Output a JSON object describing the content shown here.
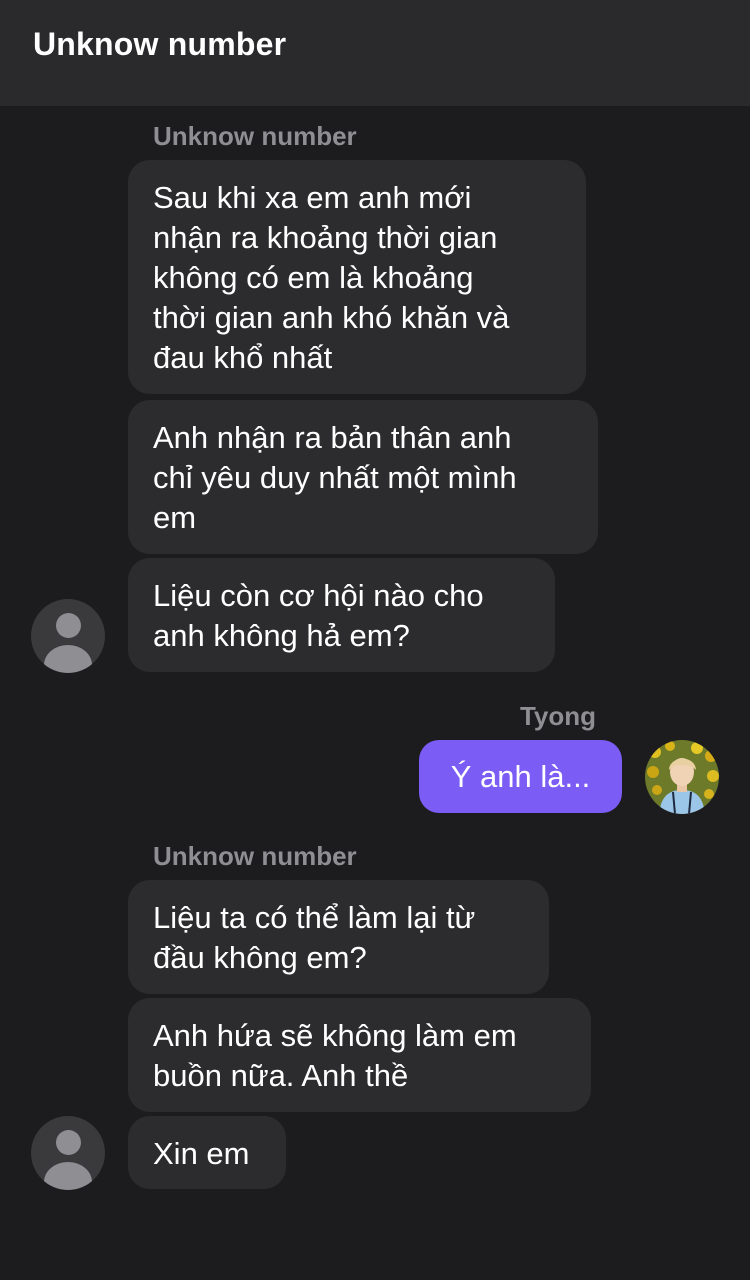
{
  "header": {
    "title": "Unknow number"
  },
  "groups": [
    {
      "sender": "Unknow number",
      "messages": [
        "Sau khi xa em anh mới\nnhận ra khoảng thời gian\nkhông có em là khoảng\nthời gian anh khó khăn và\nđau khổ nhất",
        "Anh nhận ra bản thân anh\nchỉ yêu duy nhất một mình\nem",
        "Liệu còn cơ hội nào cho\nanh không hả em?"
      ]
    },
    {
      "sender": "Tyong",
      "messages": [
        "Ý anh là..."
      ]
    },
    {
      "sender": "Unknow number",
      "messages": [
        "Liệu ta có thể làm lại từ\nđầu không em?",
        "Anh hứa sẽ không làm em\nbuồn nữa. Anh thề",
        "Xin em"
      ]
    }
  ],
  "colors": {
    "background": "#1c1c1e",
    "header": "#2a2a2c",
    "incoming_bubble": "#2c2c2e",
    "outgoing_bubble": "#7b5cf5",
    "sender_label": "#8e8e93"
  },
  "icons": {
    "contact_avatar": "person-placeholder-icon",
    "my_avatar": "profile-photo"
  }
}
